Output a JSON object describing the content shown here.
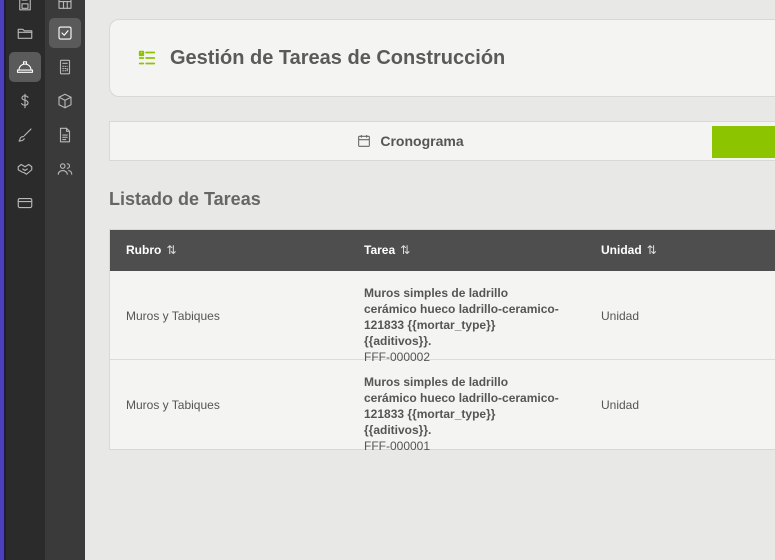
{
  "header": {
    "title": "Gestión de Tareas de Construcción"
  },
  "tabs": {
    "cronograma": "Cronograma"
  },
  "section": {
    "title": "Listado de Tareas"
  },
  "table": {
    "columns": [
      {
        "label": "Rubro",
        "sort": "⇅"
      },
      {
        "label": "Tarea",
        "sort": "⇅"
      },
      {
        "label": "Unidad",
        "sort": "⇅"
      }
    ],
    "rows": [
      {
        "rubro": "Muros y Tabiques",
        "tarea": "Muros simples de ladrillo cerámico hueco ladrillo-ceramico-121833 {{mortar_type}} {{aditivos}}.",
        "codigo": "FFF-000002",
        "unidad": "Unidad"
      },
      {
        "rubro": "Muros y Tabiques",
        "tarea": "Muros simples de ladrillo cerámico hueco ladrillo-ceramico-121833 {{mortar_type}} {{aditivos}}.",
        "codigo": "FFF-000001",
        "unidad": "Unidad"
      }
    ]
  },
  "icons": {
    "rail1": [
      "save-icon",
      "folder-icon",
      "hard-hat-icon",
      "dollar-icon",
      "brush-icon",
      "handshake-icon",
      "card-icon"
    ],
    "rail2": [
      "table-icon",
      "checkbox-icon",
      "calculator-icon",
      "box-icon",
      "document-icon",
      "users-icon"
    ]
  },
  "colors": {
    "accent": "#8cc400",
    "table_header": "#4e4e4e",
    "rail_dark": "#2b2b2b"
  }
}
